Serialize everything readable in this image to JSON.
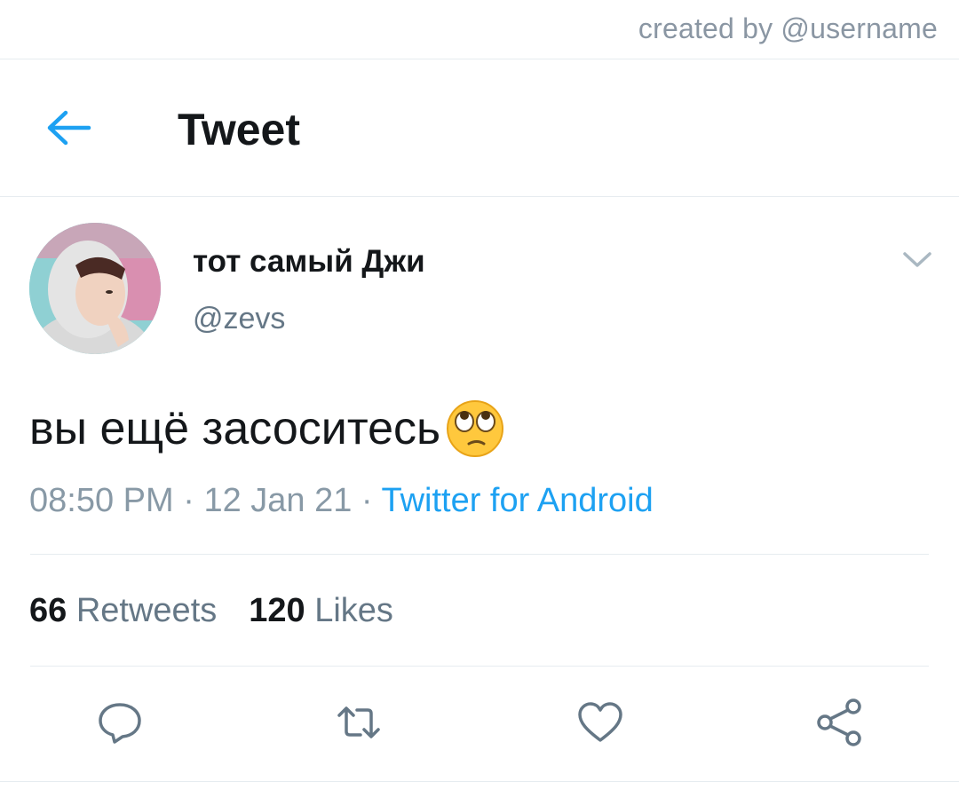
{
  "watermark": {
    "text": "created by @username"
  },
  "header": {
    "title": "Tweet",
    "back_icon": "arrow-left-icon",
    "accent": "#1da1f2"
  },
  "tweet": {
    "display_name": "тот самый Джи",
    "handle": "@zevs",
    "text": "вы ещё засоситесь",
    "emoji": "face-with-rolling-eyes",
    "time": "08:50 PM",
    "date": "12 Jan 21",
    "source": "Twitter for Android",
    "separator": " · "
  },
  "stats": {
    "retweets_count": "66",
    "retweets_label": "Retweets",
    "likes_count": "120",
    "likes_label": "Likes"
  },
  "actions": [
    {
      "name": "reply",
      "icon": "comment-icon"
    },
    {
      "name": "retweet",
      "icon": "retweet-icon"
    },
    {
      "name": "like",
      "icon": "heart-icon"
    },
    {
      "name": "share",
      "icon": "share-icon"
    }
  ],
  "colors": {
    "primary_text": "#14171a",
    "secondary_text": "#657786",
    "link": "#1da1f2",
    "divider": "#e6ecf0"
  }
}
